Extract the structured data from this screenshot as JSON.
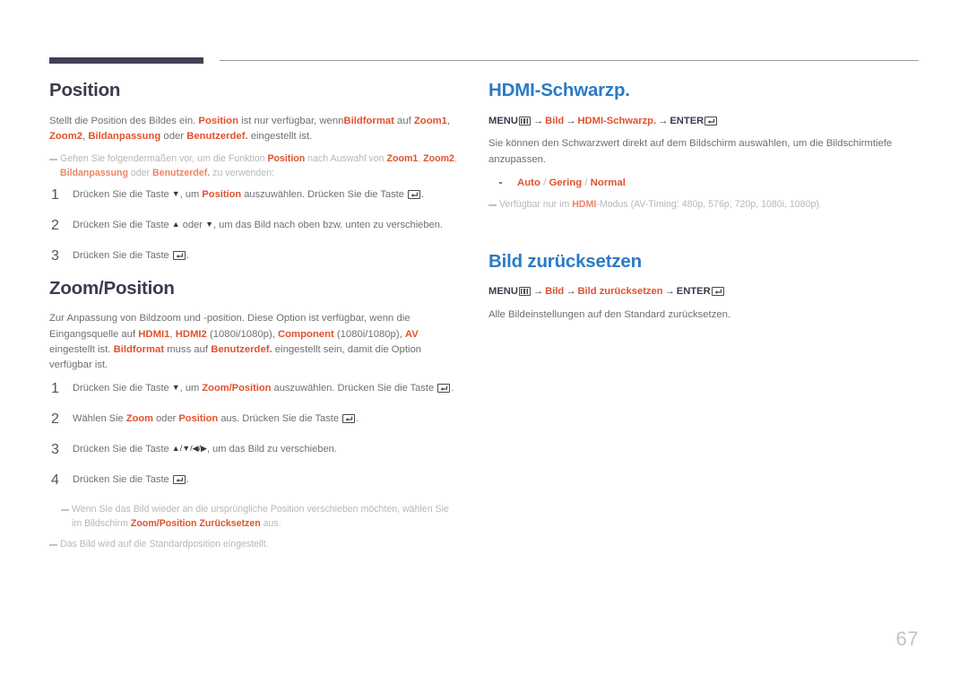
{
  "page": {
    "number": "67",
    "accent_orange": "#e1512d",
    "accent_blue": "#2b7cc4",
    "heading_dark": "#3d3a4c",
    "rule_dark": "#443f54"
  },
  "left_column": {
    "section1": {
      "title": "Position",
      "intro_parts": {
        "p1": "Stellt die Position des Bildes ein. ",
        "b1": "Position",
        "p2": " ist nur verfügbar, wenn",
        "b2": "Bildformat",
        "p3": " auf ",
        "b3": "Zoom1",
        "p4": ", ",
        "b4": "Zoom2",
        "p5": ", ",
        "b5": "Bildanpassung",
        "p6": " oder ",
        "b6": "Benutzerdef.",
        "p7": " eingestellt ist."
      },
      "note": {
        "t1": "Gehen Sie folgendermaßen vor, um die Funktion ",
        "b1": "Position",
        "t2": " nach Auswahl von ",
        "b2": "Zoom1",
        "t3": ", ",
        "b3": "Zoom2",
        "t4": ", ",
        "b4": "Bildanpassung",
        "t5": " oder ",
        "b5": "Benutzerdef.",
        "t6": " zu verwenden:"
      },
      "steps": [
        {
          "num": "1",
          "t1": "Drücken Sie die Taste ",
          "arrow": "▼",
          "t2": ", um ",
          "b1": "Position",
          "t3": " auszuwählen. Drücken Sie die Taste ",
          "t4": "."
        },
        {
          "num": "2",
          "t1": "Drücken Sie die Taste ",
          "arrow": "▲",
          "t2": " oder ",
          "arrow2": "▼",
          "t3": ", um das Bild nach oben bzw. unten zu verschieben.",
          "t4": ""
        },
        {
          "num": "3",
          "t1": "Drücken Sie die Taste ",
          "t4": "."
        }
      ]
    },
    "section2": {
      "title": "Zoom/Position",
      "intro_parts": {
        "p1": "Zur Anpassung von Bildzoom und -position. Diese Option ist verfügbar, wenn die Eingangsquelle auf ",
        "b1": "HDMI1",
        "p2": ", ",
        "b2": "HDMI2",
        "p3": " (1080i/1080p), ",
        "b3": "Component",
        "p4": " (1080i/1080p), ",
        "b4": "AV",
        "p5": " eingestellt ist. ",
        "b5": "Bildformat",
        "p6": " muss auf ",
        "b6": "Benutzerdef.",
        "p7": " eingestellt sein, damit die Option verfügbar ist."
      },
      "steps": [
        {
          "num": "1",
          "t1": "Drücken Sie die Taste ",
          "arrow": "▼",
          "t2": ", um ",
          "b1": "Zoom/Position",
          "t3": " auszuwählen. Drücken Sie die Taste ",
          "t4": "."
        },
        {
          "num": "2",
          "t1": "Wählen Sie ",
          "b1": "Zoom",
          "t2": " oder ",
          "b2": "Position",
          "t3": " aus. Drücken Sie die Taste ",
          "t4": "."
        },
        {
          "num": "3",
          "t1": "Drücken Sie die Taste ",
          "arrows": "▲/▼/◀/▶",
          "t3": ", um das Bild zu verschieben.",
          "t4": ""
        },
        {
          "num": "4",
          "t1": "Drücken Sie die Taste ",
          "t4": "."
        }
      ],
      "notes": [
        {
          "t1": "Wenn Sie das Bild wieder an die ursprüngliche Position verschieben möchten, wählen Sie im Bildschirm ",
          "b1": "Zoom/Position Zurücksetzen",
          "t2": " aus."
        },
        {
          "t1": "Das Bild wird auf die Standardposition eingestellt.",
          "b1": "",
          "t2": ""
        }
      ]
    }
  },
  "right_column": {
    "section1": {
      "title": "HDMI-Schwarzp.",
      "path": {
        "menu": "MENU",
        "arrow1": "→",
        "item1": "Bild",
        "arrow2": "→",
        "item2": "HDMI-Schwarzp.",
        "arrow3": "→",
        "enter": "ENTER"
      },
      "body": "Sie können den Schwarzwert direkt auf dem Bildschirm auswählen, um die Bildschirmtiefe anzupassen.",
      "options": {
        "o1": "Auto",
        "s1": " / ",
        "o2": "Gering",
        "s2": " / ",
        "o3": "Normal"
      },
      "note": {
        "t1": "Verfügbar nur im ",
        "b1": "HDMI",
        "t2": "-Modus (AV-Timing: 480p, 576p, 720p, 1080i, 1080p)."
      }
    },
    "section2": {
      "title": "Bild zurücksetzen",
      "path": {
        "menu": "MENU",
        "arrow1": "→",
        "item1": "Bild",
        "arrow2": "→",
        "item2": "Bild zurücksetzen",
        "arrow3": "→",
        "enter": "ENTER"
      },
      "body": "Alle Bildeinstellungen auf den Standard zurücksetzen."
    }
  }
}
